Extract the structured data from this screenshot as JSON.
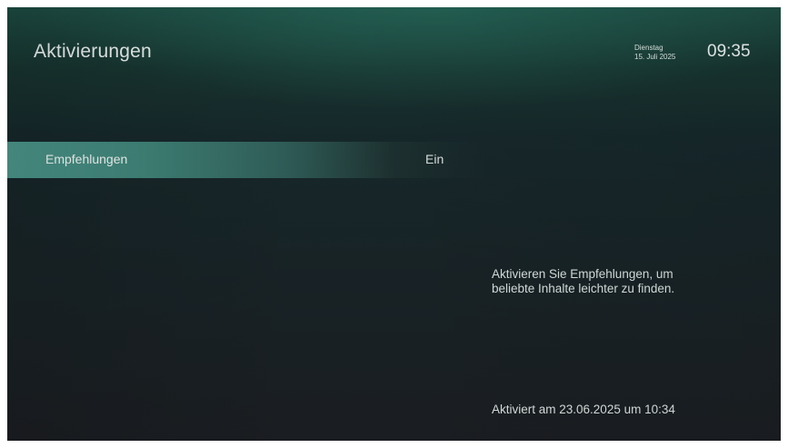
{
  "header": {
    "title": "Aktivierungen",
    "weekday": "Dienstag",
    "date": "15. Juli 2025",
    "time": "09:35"
  },
  "settings": {
    "items": [
      {
        "label": "Empfehlungen",
        "value": "Ein",
        "selected": true
      }
    ]
  },
  "details": {
    "description": "Aktivieren Sie Empfehlungen, um\nbeliebte Inhalte leichter zu finden.",
    "activation_info": "Aktiviert am 23.06.2025 um 10:34"
  },
  "colors": {
    "selection_highlight": "#4b958a",
    "background_top": "#1c4a41",
    "background_bottom": "#1a1d21",
    "text": "#e6ecea"
  }
}
